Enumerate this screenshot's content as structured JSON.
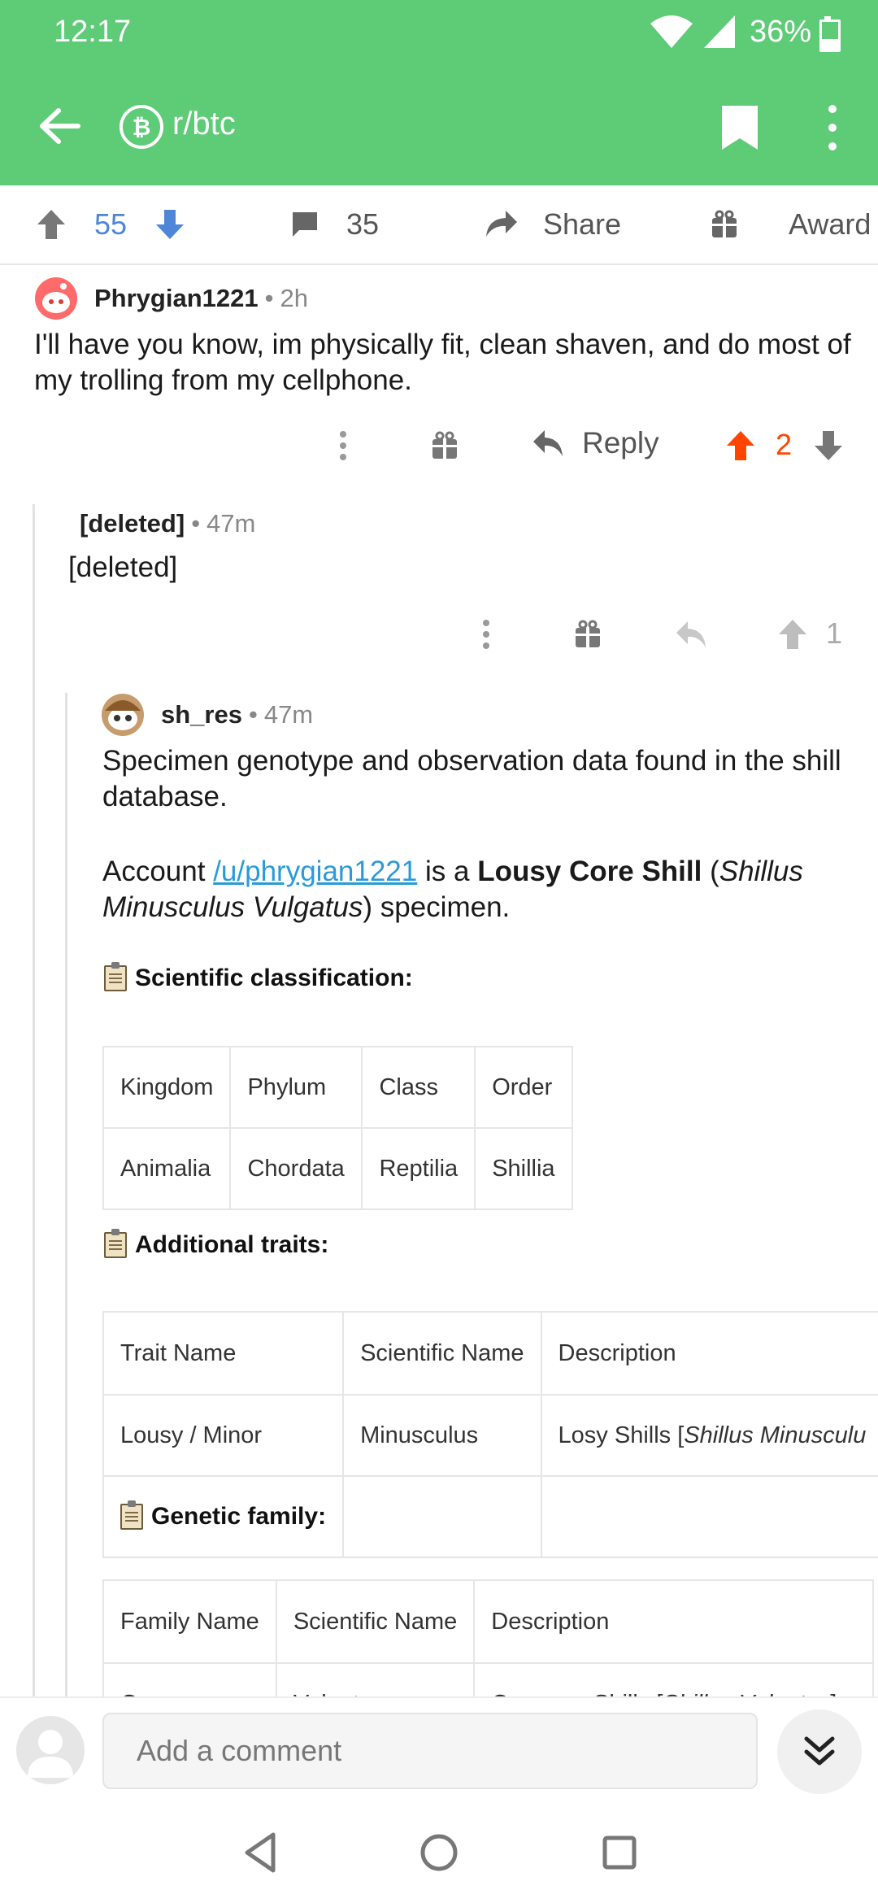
{
  "status_bar": {
    "time": "12:17",
    "battery": "36%"
  },
  "toolbar": {
    "subreddit": "r/btc"
  },
  "post_actions": {
    "upvotes": "55",
    "comments": "35",
    "share_label": "Share",
    "award_label": "Award"
  },
  "comment1": {
    "author": "Phrygian1221",
    "separator": "•",
    "age": "2h",
    "body": "I'll have you know, im physically fit, clean shaven, and do most of my trolling from my cellphone.",
    "reply_label": "Reply",
    "score": "2"
  },
  "comment2": {
    "author": "[deleted]",
    "separator": "•",
    "age": "47m",
    "body": "[deleted]",
    "score": "1"
  },
  "comment3": {
    "author": "sh_res",
    "separator": "•",
    "age": "47m",
    "intro": "Specimen genotype and observation data found in the shill database.",
    "account_prefix": "Account",
    "account_link": "/u/phrygian1221",
    "is_a": "is a",
    "classification_bold": "Lousy Core Shill",
    "open_paren": "(",
    "species_italic": "Shillus Minusculus Vulgatus",
    "close_paren": ") specimen.",
    "sci_heading": "Scientific classification:",
    "sci_table": {
      "headers": [
        "Kingdom",
        "Phylum",
        "Class",
        "Order"
      ],
      "row": [
        "Animalia",
        "Chordata",
        "Reptilia",
        "Shillia"
      ]
    },
    "traits_heading": "Additional traits:",
    "traits_table": {
      "headers": [
        "Trait Name",
        "Scientific Name",
        "Description"
      ],
      "row": [
        "Lousy / Minor",
        "Minusculus",
        "Losy Shills [",
        "Shillus Minusculu"
      ]
    },
    "genetic_heading": "Genetic family:",
    "family_table": {
      "headers": [
        "Family Name",
        "Scientific Name",
        "Description"
      ],
      "row": [
        "Common",
        "Vulgatus",
        "Common Shills [",
        "Shillus Vulgatus",
        "] a"
      ]
    }
  },
  "comment_bar": {
    "placeholder": "Add a comment"
  },
  "colors": {
    "header_green": "#5ecb77",
    "upvote_orange": "#ff4500",
    "vote_blue": "#4f86d9",
    "link_blue": "#2a9bd8"
  }
}
